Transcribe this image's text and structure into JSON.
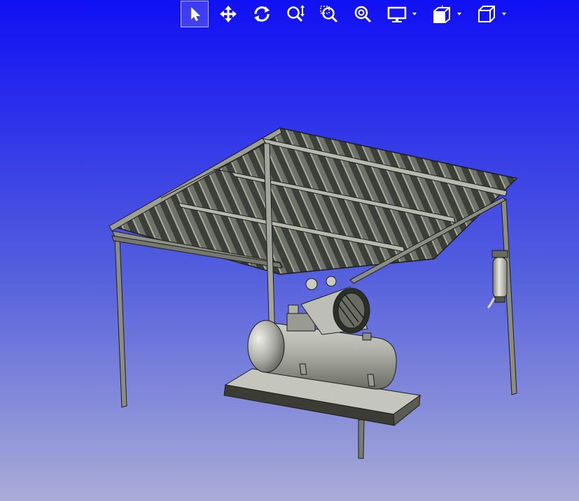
{
  "viewer": {
    "background_top": "#1010f4",
    "background_bottom": "#a9acd6",
    "active_tool": "select"
  },
  "toolbar": {
    "buttons": [
      {
        "icon": "select-arrow-icon"
      },
      {
        "icon": "pan-move-icon"
      },
      {
        "icon": "rotate-icon"
      },
      {
        "icon": "zoom-icon"
      },
      {
        "icon": "zoom-window-icon"
      },
      {
        "icon": "zoom-fit-icon"
      },
      {
        "icon": "display-mode-icon",
        "dropdown": true
      },
      {
        "icon": "section-view-icon",
        "dropdown": true
      },
      {
        "icon": "view-cube-icon",
        "dropdown": true
      }
    ]
  },
  "model": {
    "description_visible": false,
    "parts": [
      "corrugated-roof",
      "support-posts",
      "air-compressor",
      "compressor-tank",
      "base-platform",
      "fire-extinguisher"
    ]
  }
}
